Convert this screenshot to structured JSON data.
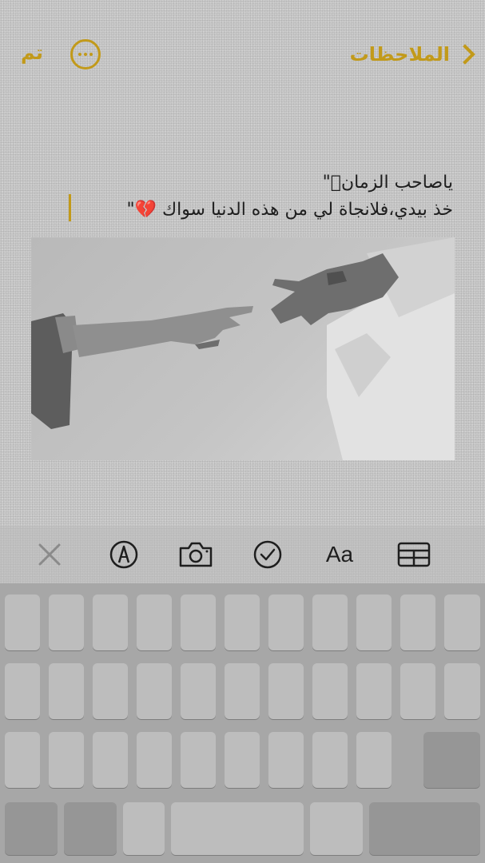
{
  "nav": {
    "back_label": "الملاحظات",
    "done_label": "تم",
    "accent_color": "#c29a1a"
  },
  "note": {
    "line1": "ياصاحب الزمانؑ\"",
    "line2": "خذ بيدي،فلانجاة لي من هذه الدنيا سواك 💔\""
  },
  "toolbar": {
    "close_icon": "close-icon",
    "markup_icon": "pen-markup-icon",
    "camera_icon": "camera-icon",
    "checklist_icon": "checkmark-circle-icon",
    "format_label": "Aa",
    "table_icon": "table-icon"
  }
}
